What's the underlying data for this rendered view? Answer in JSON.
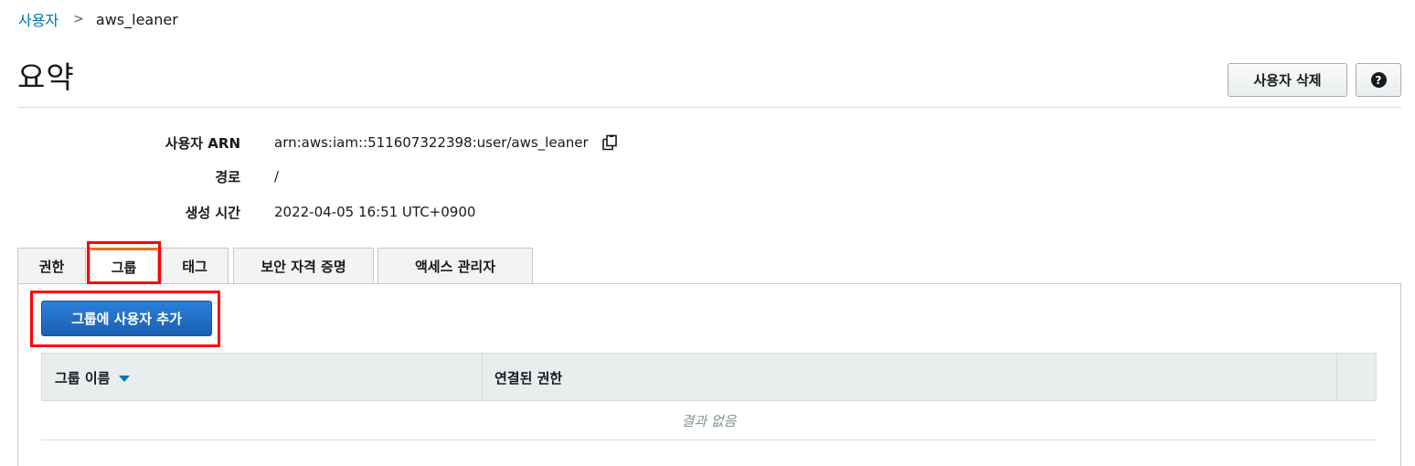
{
  "breadcrumb": {
    "parent": "사용자",
    "separator": ">",
    "current": "aws_leaner"
  },
  "page": {
    "title": "요약"
  },
  "header_actions": {
    "delete_user": "사용자 삭제",
    "help": "?"
  },
  "summary": {
    "arn_label": "사용자 ARN",
    "arn_value": "arn:aws:iam::511607322398:user/aws_leaner",
    "path_label": "경로",
    "path_value": "/",
    "created_label": "생성 시간",
    "created_value": "2022-04-05 16:51 UTC+0900"
  },
  "tabs": [
    {
      "label": "권한",
      "active": false
    },
    {
      "label": "그룹",
      "active": true
    },
    {
      "label": "태그",
      "active": false
    },
    {
      "label": "보안 자격 증명",
      "active": false
    },
    {
      "label": "액세스 관리자",
      "active": false
    }
  ],
  "groups_panel": {
    "add_button": "그룹에 사용자 추가",
    "columns": [
      "그룹 이름",
      "연결된 권한"
    ],
    "rows": [],
    "empty_message": "결과 없음"
  },
  "colors": {
    "link": "#0073bb",
    "primary_button": "#1f6fc9",
    "active_tab_accent": "#ec7211",
    "annotation_highlight": "#ff0000"
  },
  "icons": {
    "copy": "copy-icon",
    "sort": "caret-down-icon",
    "help": "question-circle-icon"
  }
}
